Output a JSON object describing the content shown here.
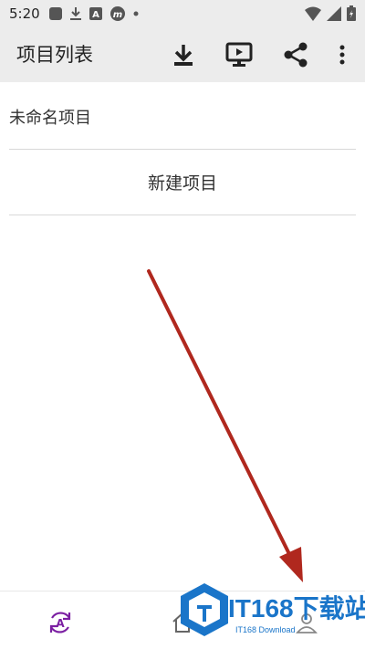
{
  "status_bar": {
    "time": "5:20",
    "left_icons": [
      "square-app-icon",
      "download-icon",
      "a-badge-icon",
      "m-badge-icon",
      "dot-icon"
    ],
    "right_icons": [
      "wifi-icon",
      "signal-icon",
      "battery-icon"
    ]
  },
  "app_bar": {
    "title": "项目列表",
    "actions": [
      "download-icon",
      "present-icon",
      "share-icon",
      "more-vert-icon"
    ]
  },
  "projects": [
    {
      "name": "未命名项目"
    }
  ],
  "new_project_label": "新建项目",
  "bottom_nav": {
    "items": [
      "a-sync-icon",
      "home-icon",
      "profile-icon"
    ]
  },
  "watermark": {
    "text": "IT168下载站",
    "sub": "IT168 Download"
  },
  "colors": {
    "bar_bg": "#ececec",
    "arrow": "#b0281e",
    "nav_accent": "#7b1fa2",
    "watermark": "#1a75c9"
  }
}
